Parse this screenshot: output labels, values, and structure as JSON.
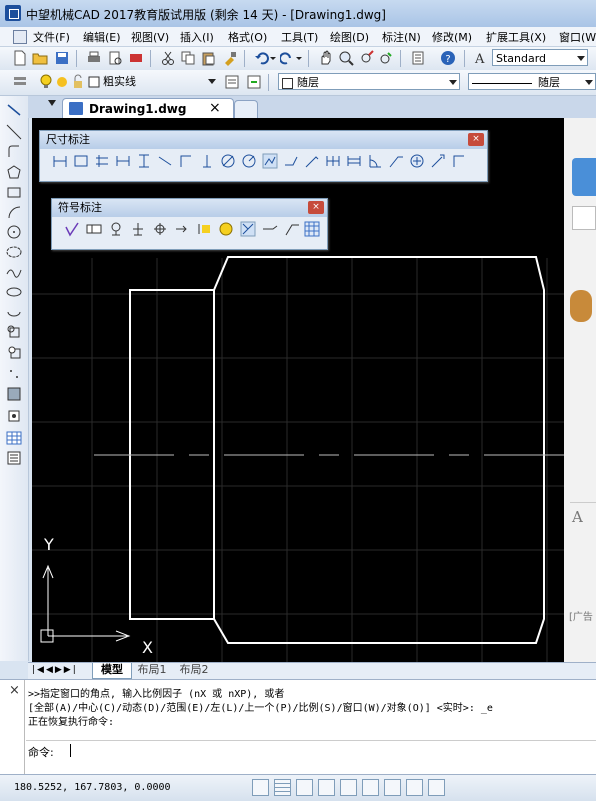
{
  "window": {
    "title": "中望机械CAD 2017教育版试用版 (剩余 14 天) - [Drawing1.dwg]"
  },
  "menu": [
    "文件(F)",
    "编辑(E)",
    "视图(V)",
    "插入(I)",
    "格式(O)",
    "工具(T)",
    "绘图(D)",
    "标注(N)",
    "修改(M)",
    "扩展工具(X)",
    "窗口(W"
  ],
  "toolbar": {
    "text_style": "Standard",
    "linetype": "粗实线",
    "layer": "随层",
    "lineweight_by": "随层"
  },
  "tabs": {
    "active": "Drawing1.dwg",
    "close": "×"
  },
  "panels": {
    "dim": "尺寸标注",
    "sym": "符号标注",
    "close": "×"
  },
  "ucs": {
    "x": "X",
    "y": "Y"
  },
  "layouts": {
    "model": "模型",
    "l1": "布局1",
    "l2": "布局2"
  },
  "command": {
    "line1": ">>指定窗口的角点, 输入比例因子 (nX 或 nXP), 或者",
    "line2": "[全部(A)/中心(C)/动态(D)/范围(E)/左(L)/上一个(P)/比例(S)/窗口(W)/对象(O)] <实时>: _e",
    "line3": "正在恢复执行命令:",
    "prompt": "命令:",
    "close": "×"
  },
  "status": {
    "coords": "180.5252, 167.7803, 0.0000"
  },
  "rightpanel": {
    "ad": "[广告",
    "a": "A"
  },
  "colors": {
    "canvas": "#000000",
    "geometry": "#ffffff",
    "accent": "#1d4f9c"
  }
}
